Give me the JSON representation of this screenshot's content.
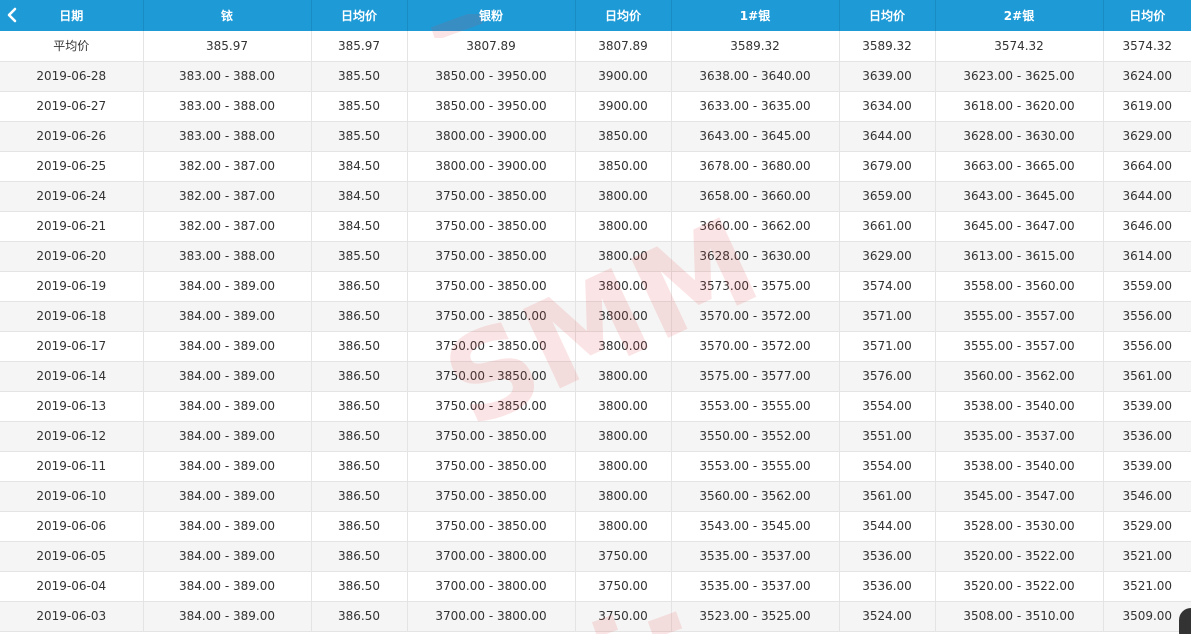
{
  "table": {
    "headers": [
      "日期",
      "铱",
      "日均价",
      "银粉",
      "日均价",
      "1#银",
      "日均价",
      "2#银",
      "日均价"
    ],
    "average_row": [
      "平均价",
      "385.97",
      "385.97",
      "3807.89",
      "3807.89",
      "3589.32",
      "3589.32",
      "3574.32",
      "3574.32"
    ],
    "rows": [
      [
        "2019-06-28",
        "383.00 - 388.00",
        "385.50",
        "3850.00 - 3950.00",
        "3900.00",
        "3638.00 - 3640.00",
        "3639.00",
        "3623.00 - 3625.00",
        "3624.00"
      ],
      [
        "2019-06-27",
        "383.00 - 388.00",
        "385.50",
        "3850.00 - 3950.00",
        "3900.00",
        "3633.00 - 3635.00",
        "3634.00",
        "3618.00 - 3620.00",
        "3619.00"
      ],
      [
        "2019-06-26",
        "383.00 - 388.00",
        "385.50",
        "3800.00 - 3900.00",
        "3850.00",
        "3643.00 - 3645.00",
        "3644.00",
        "3628.00 - 3630.00",
        "3629.00"
      ],
      [
        "2019-06-25",
        "382.00 - 387.00",
        "384.50",
        "3800.00 - 3900.00",
        "3850.00",
        "3678.00 - 3680.00",
        "3679.00",
        "3663.00 - 3665.00",
        "3664.00"
      ],
      [
        "2019-06-24",
        "382.00 - 387.00",
        "384.50",
        "3750.00 - 3850.00",
        "3800.00",
        "3658.00 - 3660.00",
        "3659.00",
        "3643.00 - 3645.00",
        "3644.00"
      ],
      [
        "2019-06-21",
        "382.00 - 387.00",
        "384.50",
        "3750.00 - 3850.00",
        "3800.00",
        "3660.00 - 3662.00",
        "3661.00",
        "3645.00 - 3647.00",
        "3646.00"
      ],
      [
        "2019-06-20",
        "383.00 - 388.00",
        "385.50",
        "3750.00 - 3850.00",
        "3800.00",
        "3628.00 - 3630.00",
        "3629.00",
        "3613.00 - 3615.00",
        "3614.00"
      ],
      [
        "2019-06-19",
        "384.00 - 389.00",
        "386.50",
        "3750.00 - 3850.00",
        "3800.00",
        "3573.00 - 3575.00",
        "3574.00",
        "3558.00 - 3560.00",
        "3559.00"
      ],
      [
        "2019-06-18",
        "384.00 - 389.00",
        "386.50",
        "3750.00 - 3850.00",
        "3800.00",
        "3570.00 - 3572.00",
        "3571.00",
        "3555.00 - 3557.00",
        "3556.00"
      ],
      [
        "2019-06-17",
        "384.00 - 389.00",
        "386.50",
        "3750.00 - 3850.00",
        "3800.00",
        "3570.00 - 3572.00",
        "3571.00",
        "3555.00 - 3557.00",
        "3556.00"
      ],
      [
        "2019-06-14",
        "384.00 - 389.00",
        "386.50",
        "3750.00 - 3850.00",
        "3800.00",
        "3575.00 - 3577.00",
        "3576.00",
        "3560.00 - 3562.00",
        "3561.00"
      ],
      [
        "2019-06-13",
        "384.00 - 389.00",
        "386.50",
        "3750.00 - 3850.00",
        "3800.00",
        "3553.00 - 3555.00",
        "3554.00",
        "3538.00 - 3540.00",
        "3539.00"
      ],
      [
        "2019-06-12",
        "384.00 - 389.00",
        "386.50",
        "3750.00 - 3850.00",
        "3800.00",
        "3550.00 - 3552.00",
        "3551.00",
        "3535.00 - 3537.00",
        "3536.00"
      ],
      [
        "2019-06-11",
        "384.00 - 389.00",
        "386.50",
        "3750.00 - 3850.00",
        "3800.00",
        "3553.00 - 3555.00",
        "3554.00",
        "3538.00 - 3540.00",
        "3539.00"
      ],
      [
        "2019-06-10",
        "384.00 - 389.00",
        "386.50",
        "3750.00 - 3850.00",
        "3800.00",
        "3560.00 - 3562.00",
        "3561.00",
        "3545.00 - 3547.00",
        "3546.00"
      ],
      [
        "2019-06-06",
        "384.00 - 389.00",
        "386.50",
        "3750.00 - 3850.00",
        "3800.00",
        "3543.00 - 3545.00",
        "3544.00",
        "3528.00 - 3530.00",
        "3529.00"
      ],
      [
        "2019-06-05",
        "384.00 - 389.00",
        "386.50",
        "3700.00 - 3800.00",
        "3750.00",
        "3535.00 - 3537.00",
        "3536.00",
        "3520.00 - 3522.00",
        "3521.00"
      ],
      [
        "2019-06-04",
        "384.00 - 389.00",
        "386.50",
        "3700.00 - 3800.00",
        "3750.00",
        "3535.00 - 3537.00",
        "3536.00",
        "3520.00 - 3522.00",
        "3521.00"
      ],
      [
        "2019-06-03",
        "384.00 - 389.00",
        "386.50",
        "3700.00 - 3800.00",
        "3750.00",
        "3523.00 - 3525.00",
        "3524.00",
        "3508.00 - 3510.00",
        "3509.00"
      ]
    ]
  },
  "watermark": {
    "text": "SMM",
    "color": "#e8393c"
  },
  "icons": {
    "back": "chevron-left-icon"
  },
  "colors": {
    "header_bg": "#1e9bd7",
    "header_text": "#ffffff",
    "row_alt_bg": "#f5f5f5"
  }
}
